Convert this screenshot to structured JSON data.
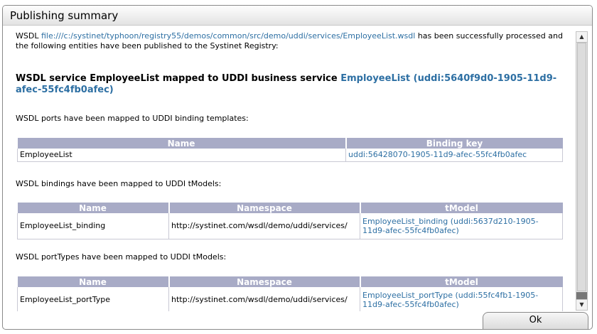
{
  "dialog": {
    "title": "Publishing summary",
    "ok_label": "Ok"
  },
  "intro": {
    "prefix": "WSDL ",
    "wsdl_link": "file:///c:/systinet/typhoon/registry55/demos/common/src/demo/uddi/services/EmployeeList.wsdl",
    "suffix": " has been successfully processed and the following entities have been published to the Systinet Registry:"
  },
  "service": {
    "heading_prefix": "WSDL service EmployeeList mapped to UDDI business service ",
    "service_link": "EmployeeList (uddi:5640f9d0-1905-11d9-afec-55fc4fb0afec)"
  },
  "ports": {
    "caption": "WSDL ports have been mapped to UDDI binding templates:",
    "headers": [
      "Name",
      "Binding key"
    ],
    "rows": [
      {
        "name": "EmployeeList",
        "key": "uddi:56428070-1905-11d9-afec-55fc4fb0afec"
      }
    ]
  },
  "bindings": {
    "caption": "WSDL bindings have been mapped to UDDI tModels:",
    "headers": [
      "Name",
      "Namespace",
      "tModel"
    ],
    "rows": [
      {
        "name": "EmployeeList_binding",
        "namespace": "http://systinet.com/wsdl/demo/uddi/services/",
        "tmodel": "EmployeeList_binding (uddi:5637d210-1905-11d9-afec-55fc4fb0afec)"
      }
    ]
  },
  "porttypes": {
    "caption": "WSDL portTypes have been mapped to UDDI tModels:",
    "headers": [
      "Name",
      "Namespace",
      "tModel"
    ],
    "rows": [
      {
        "name": "EmployeeList_portType",
        "namespace": "http://systinet.com/wsdl/demo/uddi/services/",
        "tmodel": "EmployeeList_portType (uddi:55fc4fb1-1905-11d9-afec-55fc4fb0afec)"
      }
    ]
  },
  "colors": {
    "link": "#2d6fa3",
    "table_header": "#a8abc6"
  }
}
